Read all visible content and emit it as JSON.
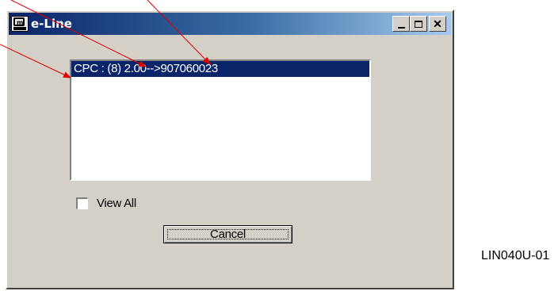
{
  "window": {
    "title": "e-Line",
    "icon": "e-line-app-icon",
    "buttons": {
      "minimize": "minimize-icon",
      "maximize": "maximize-icon",
      "close": "close-icon",
      "close_glyph": "✕"
    }
  },
  "list": {
    "items": [
      {
        "label": "CPC : (8) 2.00-->907060023",
        "selected": true
      }
    ]
  },
  "view_all": {
    "label": "View All",
    "checked": false
  },
  "cancel_button": {
    "label": "Cancel"
  },
  "caption": "LIN040U-01",
  "colors": {
    "titlebar_start": "#0a246a",
    "titlebar_end": "#a6caf0",
    "selection": "#0a246a",
    "arrow": "#e00000",
    "window_bg": "#d4d0c8"
  }
}
